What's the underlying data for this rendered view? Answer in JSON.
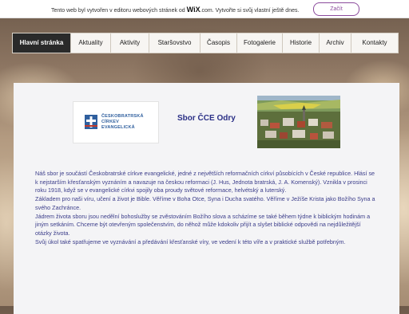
{
  "wix_bar": {
    "message_before": "Tento web byl vytvořen v editoru webových stránek od ",
    "brand": "WiX",
    "message_after": ".com. Vytvořte si svůj vlastní ještě dnes.",
    "cta_label": "Začít"
  },
  "nav": {
    "items": [
      {
        "label": "Hlavní stránka",
        "active": true
      },
      {
        "label": "Aktuality"
      },
      {
        "label": "Aktivity"
      },
      {
        "label": "Staršovstvo"
      },
      {
        "label": "Časopis"
      },
      {
        "label": "Fotogalerie"
      },
      {
        "label": "Historie"
      },
      {
        "label": "Archiv"
      },
      {
        "label": "Kontakty"
      }
    ]
  },
  "logo": {
    "line1": "ČESKOBRATRSKÁ",
    "line2": "CÍRKEV",
    "line3": "EVANGELICKÁ",
    "color": "#2f5f9e",
    "accent": "#c0392b"
  },
  "page_title": "Sbor ČCE Odry",
  "body_paragraphs": [
    "Náš sbor je součástí Českobratrské církve evangelické,   jedné z největších reformačních církví  působících v České republice. Hlásí se k nejstarším křesťanským vyznáním a navazuje na českou reformaci (J. Hus, Jednota bratrská, J. A. Komenský). Vznikla v prosinci roku 1918, když se v evangelické církvi spojily oba proudy světové reformace, helvétský a luterský.",
    "Základem pro naši víru, učení a život je Bible. Věříme v Boha Otce, Syna i Ducha svatého. Věříme v  Ježíše Krista jako Božího Syna a svého Zachránce.",
    "Jádrem života sboru jsou nedělní bohoslužby se zvěstováním Božího slova a scházíme se také během týdne k biblickým hodinám a jiným setkáním. Chceme být otevřeným společenstvím, do něhož může kdokoliv přijít a slyšet biblické odpovědi na nejdůležitější otázky života.",
    "Svůj úkol také spatřujeme ve vyznávání a předávání křesťanské víry, ve vedení k této víře a v praktické službě potřebným."
  ],
  "colors": {
    "text": "#3b3d8a",
    "title": "#2a2f86",
    "cta": "#8b4a9c",
    "nav_active_bg": "#2a2a2a"
  }
}
